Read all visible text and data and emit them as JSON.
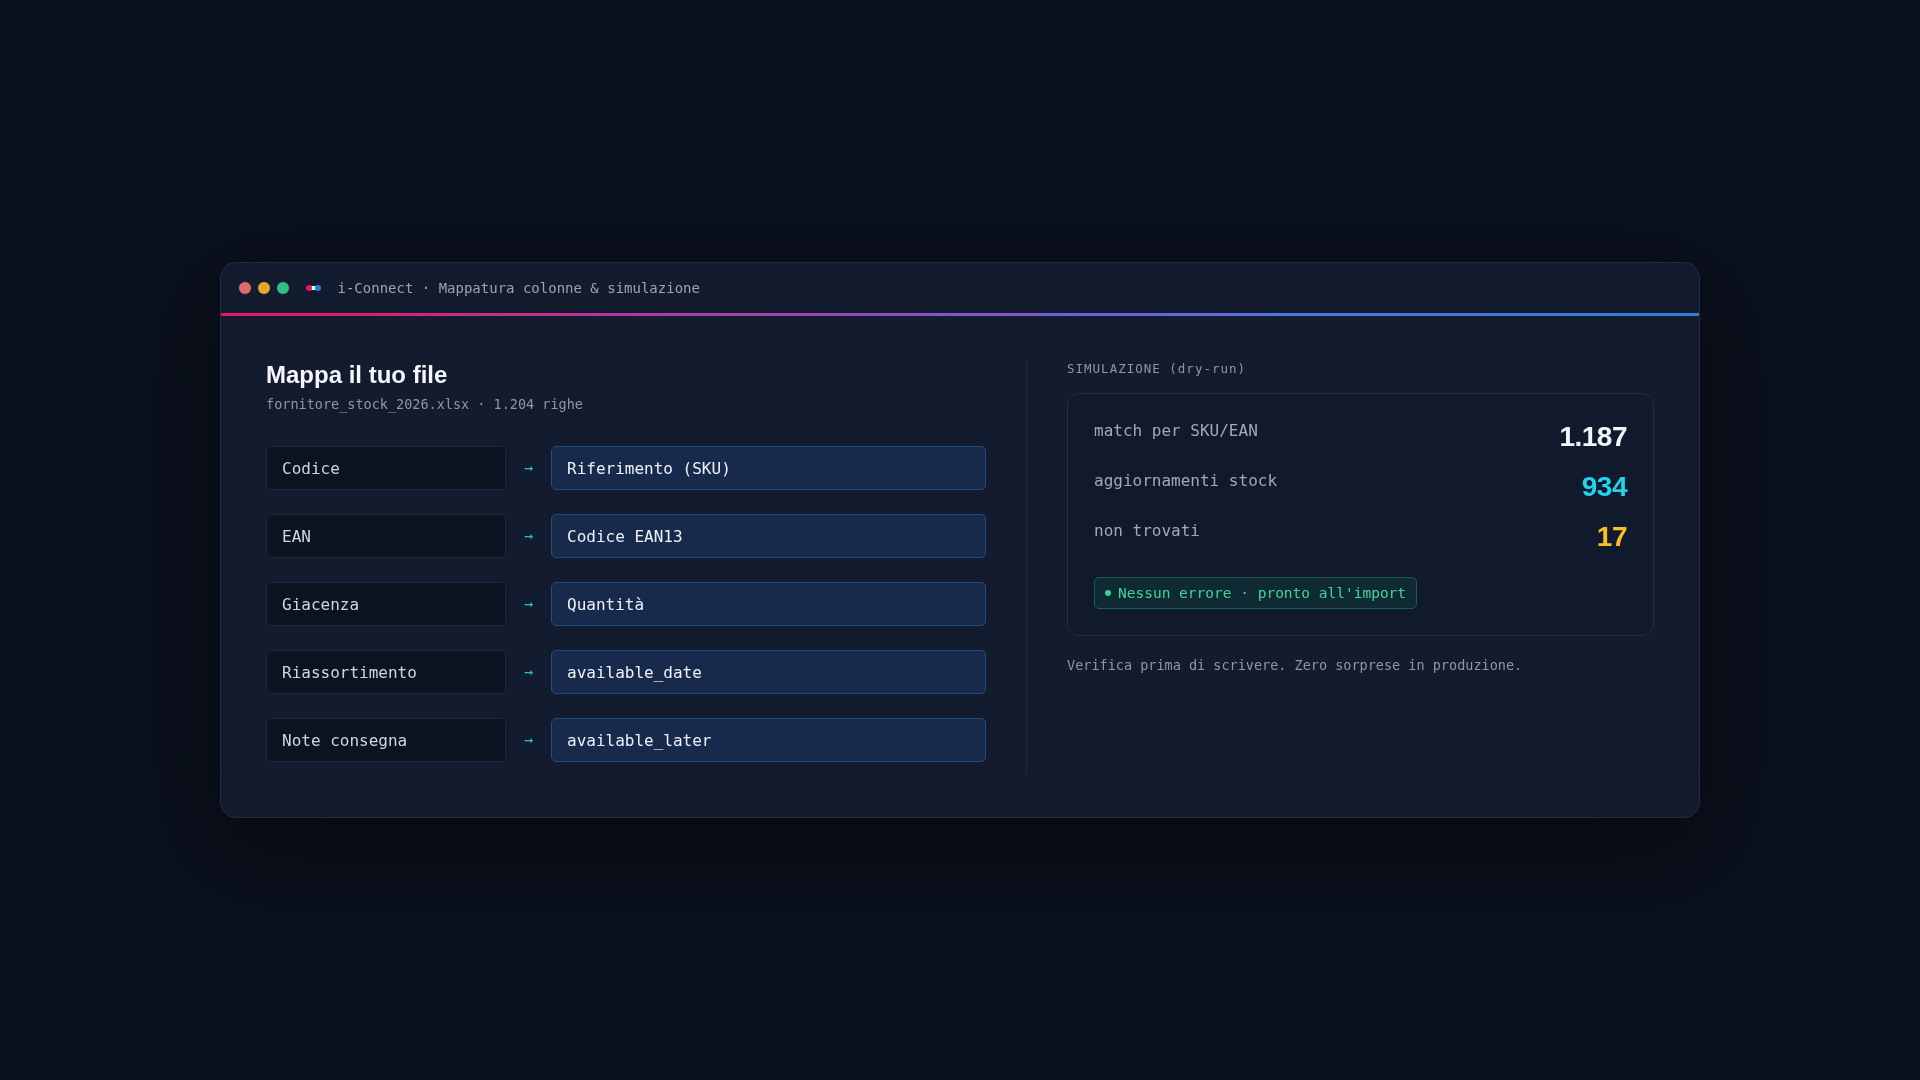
{
  "window": {
    "title": "i-Connect · Mappatura colonne & simulazione"
  },
  "mapping": {
    "title": "Mappa il tuo file",
    "subtitle": "fornitore_stock_2026.xlsx · 1.204 righe",
    "rows": [
      {
        "source": "Codice",
        "arrow": "→",
        "target": "Riferimento (SKU)"
      },
      {
        "source": "EAN",
        "arrow": "→",
        "target": "Codice EAN13"
      },
      {
        "source": "Giacenza",
        "arrow": "→",
        "target": "Quantità"
      },
      {
        "source": "Riassortimento",
        "arrow": "→",
        "target": "available_date"
      },
      {
        "source": "Note consegna",
        "arrow": "→",
        "target": "available_later"
      }
    ]
  },
  "simulation": {
    "label": "SIMULAZIONE (dry-run)",
    "stats": [
      {
        "label": "match per SKU/EAN",
        "value": "1.187",
        "color": "#f1f5f9"
      },
      {
        "label": "aggiornamenti stock",
        "value": "934",
        "color": "#22d3ee"
      },
      {
        "label": "non trovati",
        "value": "17",
        "color": "#fbbf24"
      }
    ],
    "status": {
      "text": "Nessun errore · pronto all'import"
    },
    "note": "Verifica prima di scrivere. Zero sorprese in produzione."
  }
}
